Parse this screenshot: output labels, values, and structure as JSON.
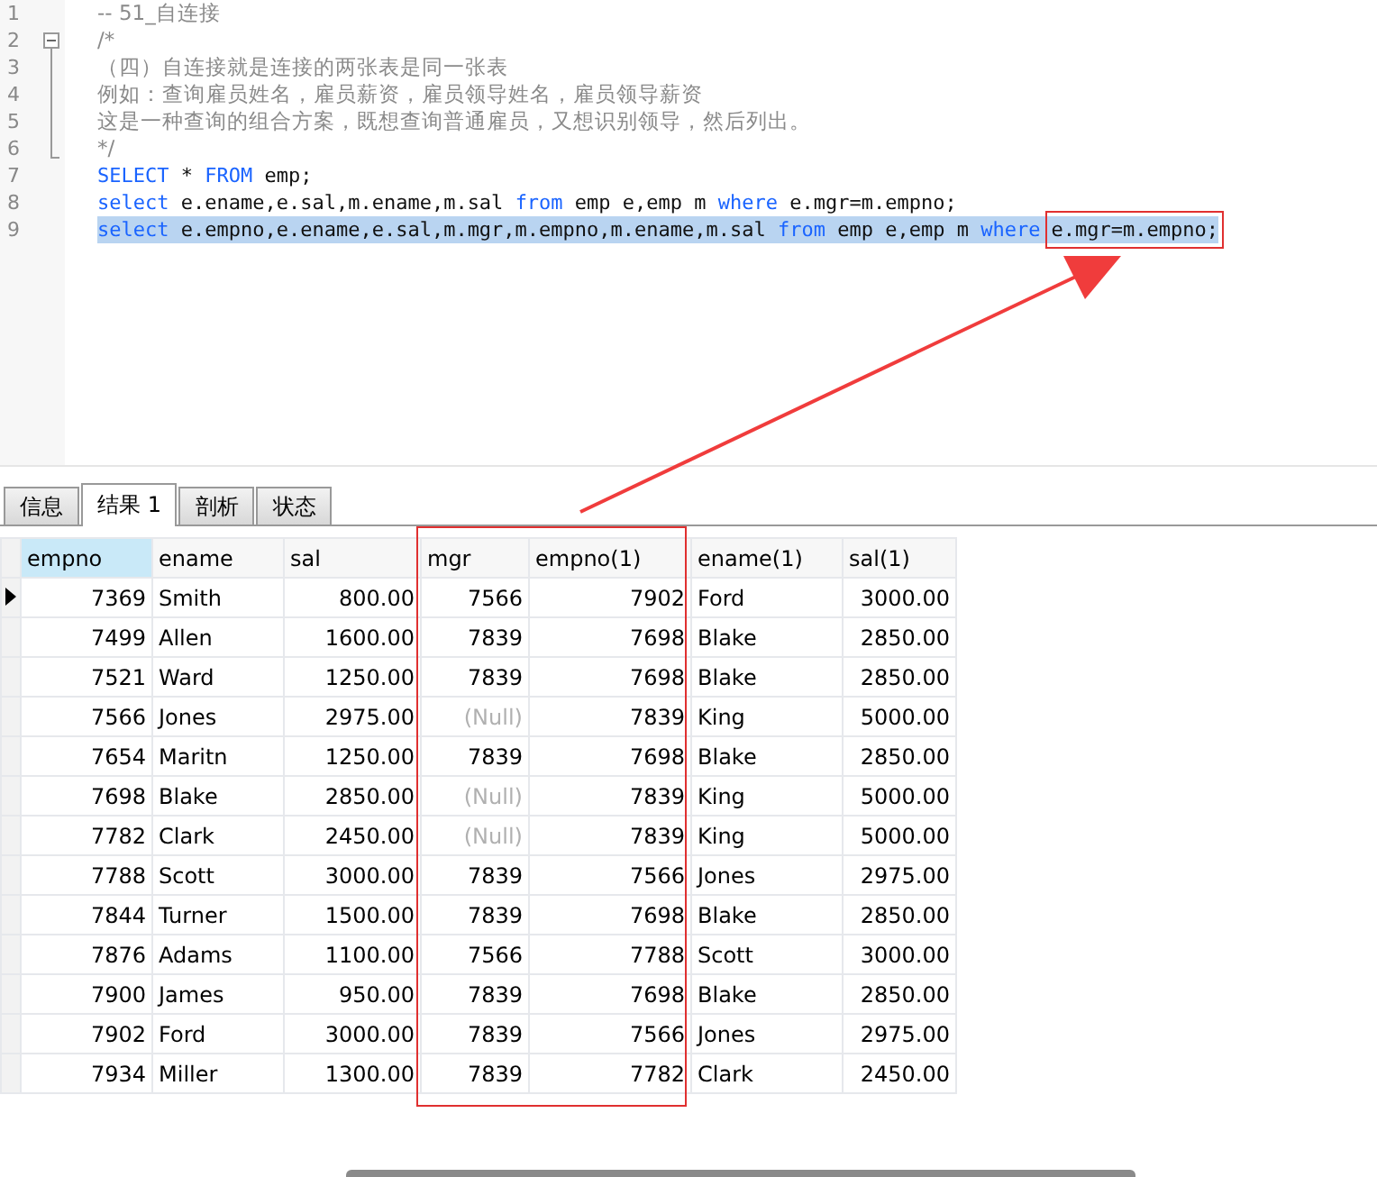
{
  "editor": {
    "lines": [
      {
        "number": "1",
        "selected": false,
        "tokens": [
          {
            "text": "-- 51_自连接",
            "kind": "comment"
          }
        ]
      },
      {
        "number": "2",
        "expanded": true,
        "selected": false,
        "tokens": [
          {
            "text": "/*",
            "kind": "comment"
          }
        ]
      },
      {
        "number": "3",
        "selected": false,
        "tokens": [
          {
            "text": "（四）自连接就是连接的两张表是同一张表",
            "kind": "comment"
          }
        ]
      },
      {
        "number": "4",
        "selected": false,
        "tokens": [
          {
            "text": "例如：查询雇员姓名，雇员薪资，雇员领导姓名，雇员领导薪资",
            "kind": "comment"
          }
        ]
      },
      {
        "number": "5",
        "selected": false,
        "tokens": [
          {
            "text": "这是一种查询的组合方案，既想查询普通雇员，又想识别领导，然后列出。",
            "kind": "comment"
          }
        ]
      },
      {
        "number": "6",
        "selected": false,
        "tokens": [
          {
            "text": "*/",
            "kind": "comment"
          }
        ]
      },
      {
        "number": "7",
        "selected": false,
        "tokens": [
          {
            "text": "SELECT",
            "kind": "keyword"
          },
          {
            "text": " * ",
            "kind": "plain"
          },
          {
            "text": "FROM",
            "kind": "keyword"
          },
          {
            "text": " emp;",
            "kind": "plain"
          }
        ]
      },
      {
        "number": "8",
        "selected": false,
        "tokens": [
          {
            "text": "select",
            "kind": "keyword"
          },
          {
            "text": " e.ename,e.sal,m.ename,m.sal ",
            "kind": "plain"
          },
          {
            "text": "from",
            "kind": "keyword"
          },
          {
            "text": " emp e,emp m ",
            "kind": "plain"
          },
          {
            "text": "where",
            "kind": "keyword"
          },
          {
            "text": " e.mgr=m.empno;",
            "kind": "plain"
          }
        ]
      },
      {
        "number": "9",
        "selected": true,
        "tokens": [
          {
            "text": "select",
            "kind": "keyword"
          },
          {
            "text": " e.empno,e.ename,e.sal,m.mgr,m.empno,m.ename,m.sal ",
            "kind": "plain"
          },
          {
            "text": "from",
            "kind": "keyword"
          },
          {
            "text": " emp e,emp m ",
            "kind": "plain"
          },
          {
            "text": "where",
            "kind": "keyword"
          },
          {
            "text": "e.mgr=m.empno;",
            "kind": "boxed"
          }
        ]
      }
    ]
  },
  "tabs": [
    {
      "label": "信息",
      "selected": false
    },
    {
      "label": "结果 1",
      "selected": true
    },
    {
      "label": "剖析",
      "selected": false
    },
    {
      "label": "状态",
      "selected": false
    }
  ],
  "table": {
    "columns": [
      {
        "label": "empno",
        "kind": "numeric",
        "selected": true
      },
      {
        "label": "ename",
        "kind": "text",
        "selected": false
      },
      {
        "label": "sal",
        "kind": "numeric",
        "selected": false
      },
      {
        "label": "mgr",
        "kind": "numeric",
        "selected": false,
        "boxed": true
      },
      {
        "label": "empno(1)",
        "kind": "numeric",
        "selected": false,
        "boxed": true
      },
      {
        "label": "ename(1)",
        "kind": "text",
        "selected": false
      },
      {
        "label": "sal(1)",
        "kind": "numeric",
        "selected": false
      }
    ],
    "rows": [
      {
        "selected": true,
        "cells": [
          "7369",
          "Smith",
          "800.00",
          "7566",
          "7902",
          "Ford",
          "3000.00"
        ]
      },
      {
        "selected": false,
        "cells": [
          "7499",
          "Allen",
          "1600.00",
          "7839",
          "7698",
          "Blake",
          "2850.00"
        ]
      },
      {
        "selected": false,
        "cells": [
          "7521",
          "Ward",
          "1250.00",
          "7839",
          "7698",
          "Blake",
          "2850.00"
        ]
      },
      {
        "selected": false,
        "cells": [
          "7566",
          "Jones",
          "2975.00",
          {
            "text": "(Null)",
            "null": true
          },
          "7839",
          "King",
          "5000.00"
        ]
      },
      {
        "selected": false,
        "cells": [
          "7654",
          "Maritn",
          "1250.00",
          "7839",
          "7698",
          "Blake",
          "2850.00"
        ]
      },
      {
        "selected": false,
        "cells": [
          "7698",
          "Blake",
          "2850.00",
          {
            "text": "(Null)",
            "null": true
          },
          "7839",
          "King",
          "5000.00"
        ]
      },
      {
        "selected": false,
        "cells": [
          "7782",
          "Clark",
          "2450.00",
          {
            "text": "(Null)",
            "null": true
          },
          "7839",
          "King",
          "5000.00"
        ]
      },
      {
        "selected": false,
        "cells": [
          "7788",
          "Scott",
          "3000.00",
          "7839",
          "7566",
          "Jones",
          "2975.00"
        ]
      },
      {
        "selected": false,
        "cells": [
          "7844",
          "Turner",
          "1500.00",
          "7839",
          "7698",
          "Blake",
          "2850.00"
        ]
      },
      {
        "selected": false,
        "cells": [
          "7876",
          "Adams",
          "1100.00",
          "7566",
          "7788",
          "Scott",
          "3000.00"
        ]
      },
      {
        "selected": false,
        "cells": [
          "7900",
          "James",
          "950.00",
          "7839",
          "7698",
          "Blake",
          "2850.00"
        ]
      },
      {
        "selected": false,
        "cells": [
          "7902",
          "Ford",
          "3000.00",
          "7839",
          "7566",
          "Jones",
          "2975.00"
        ]
      },
      {
        "selected": false,
        "cells": [
          "7934",
          "Miller",
          "1300.00",
          "7839",
          "7782",
          "Clark",
          "2450.00"
        ]
      }
    ]
  }
}
